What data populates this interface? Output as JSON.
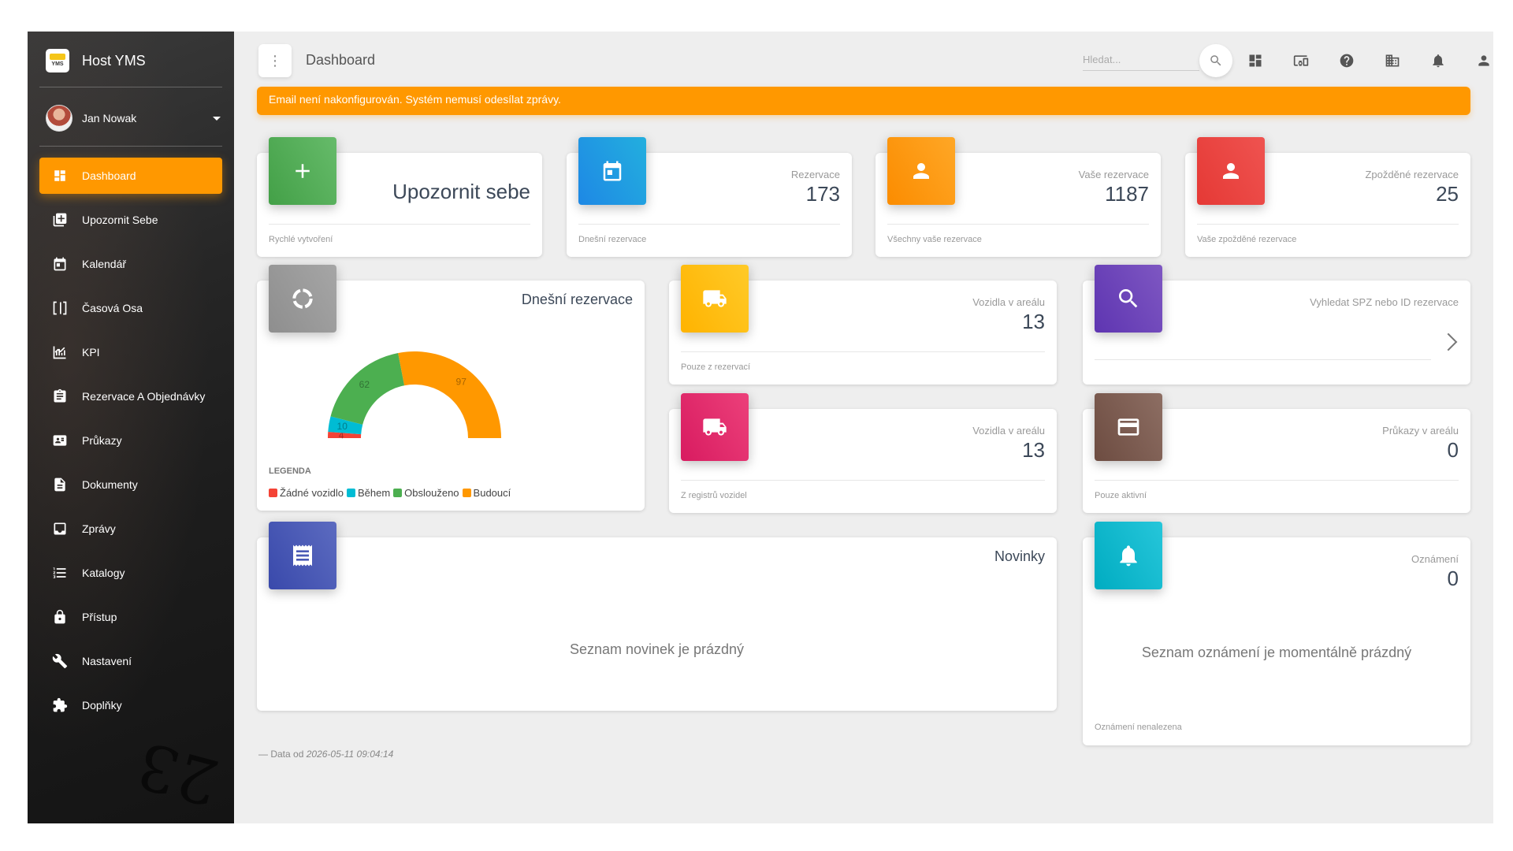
{
  "app": {
    "name": "Host YMS",
    "logo_text": "YMS"
  },
  "user": {
    "name": "Jan Nowak"
  },
  "sidebar": {
    "items": [
      {
        "label": "Dashboard",
        "icon": "dashboard-icon",
        "active": true
      },
      {
        "label": "Upozornit Sebe",
        "icon": "add-box-icon"
      },
      {
        "label": "Kalendář",
        "icon": "calendar-icon"
      },
      {
        "label": "Časová Osa",
        "icon": "timeline-icon"
      },
      {
        "label": "KPI",
        "icon": "chart-icon"
      },
      {
        "label": "Rezervace A Objednávky",
        "icon": "clipboard-icon"
      },
      {
        "label": "Průkazy",
        "icon": "badge-icon"
      },
      {
        "label": "Dokumenty",
        "icon": "document-icon"
      },
      {
        "label": "Zprávy",
        "icon": "inbox-icon"
      },
      {
        "label": "Katalogy",
        "icon": "list-icon"
      },
      {
        "label": "Přístup",
        "icon": "lock-icon"
      },
      {
        "label": "Nastavení",
        "icon": "wrench-icon"
      },
      {
        "label": "Doplňky",
        "icon": "puzzle-icon"
      }
    ],
    "background_text": "23"
  },
  "topbar": {
    "title": "Dashboard",
    "search_placeholder": "Hledat..."
  },
  "alert": {
    "text": "Email není nakonfigurován. Systém nemusí odesílat zprávy."
  },
  "cards": {
    "notify": {
      "title": "Upozornit sebe",
      "footer": "Rychlé vytvoření"
    },
    "reservations": {
      "category": "Rezervace",
      "value": "173",
      "footer": "Dnešní rezervace"
    },
    "my_reservations": {
      "category": "Vaše rezervace",
      "value": "1187",
      "footer": "Všechny vaše rezervace"
    },
    "late_reservations": {
      "category": "Zpožděné rezervace",
      "value": "25",
      "footer": "Vaše zpožděné rezervace"
    },
    "today": {
      "title": "Dnešní rezervace",
      "legend_title": "LEGENDA"
    },
    "vehicles_res": {
      "category": "Vozidla v areálu",
      "value": "13",
      "footer": "Pouze z rezervací"
    },
    "vehicles_reg": {
      "category": "Vozidla v areálu",
      "value": "13",
      "footer": "Z registrů vozidel"
    },
    "search_spz": {
      "category": "Vyhledat SPZ nebo ID rezervace"
    },
    "passes": {
      "category": "Průkazy v areálu",
      "value": "0",
      "footer": "Pouze aktivní"
    },
    "news": {
      "title": "Novinky",
      "empty": "Seznam novinek je prázdný"
    },
    "notifications": {
      "category": "Oznámení",
      "value": "0",
      "empty": "Seznam oznámení je momentálně prázdný",
      "footer": "Oznámení nenalezena"
    }
  },
  "chart_data": {
    "type": "gauge",
    "title": "Dnešní rezervace",
    "series": [
      {
        "name": "Žádné vozidlo",
        "value": 4,
        "color": "#f44336"
      },
      {
        "name": "Během",
        "value": 10,
        "color": "#00bcd4"
      },
      {
        "name": "Obslouženo",
        "value": 62,
        "color": "#4caf50"
      },
      {
        "name": "Budoucí",
        "value": 97,
        "color": "#ff9800"
      }
    ]
  },
  "footer": {
    "prefix": "— Data od",
    "timestamp": "2026-05-11 09:04:14"
  }
}
